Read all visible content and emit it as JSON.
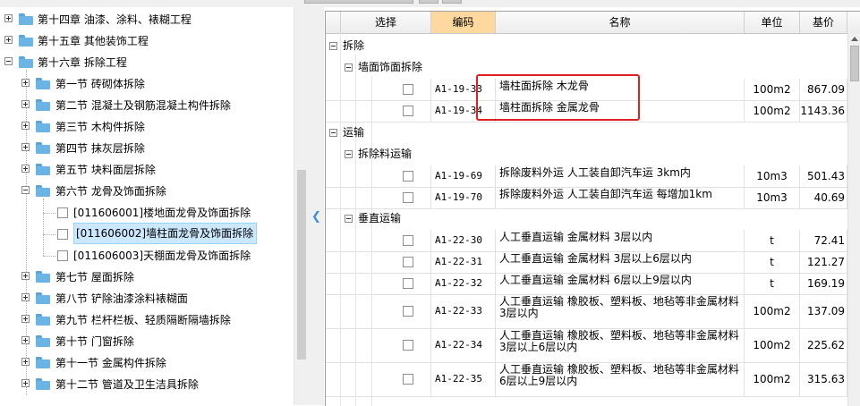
{
  "tree": [
    {
      "label": "第十四章  油漆、涂料、裱糊工程",
      "kind": "chapter",
      "expanded": false
    },
    {
      "label": "第十五章  其他装饰工程",
      "kind": "chapter",
      "expanded": false
    },
    {
      "label": "第十六章  拆除工程",
      "kind": "chapter",
      "expanded": true
    },
    {
      "label": "第一节  砖砌体拆除",
      "kind": "section",
      "expanded": false
    },
    {
      "label": "第二节  混凝土及钢筋混凝土构件拆除",
      "kind": "section",
      "expanded": false
    },
    {
      "label": "第三节  木构件拆除",
      "kind": "section",
      "expanded": false
    },
    {
      "label": "第四节  抹灰层拆除",
      "kind": "section",
      "expanded": false
    },
    {
      "label": "第五节  块料面层拆除",
      "kind": "section",
      "expanded": false
    },
    {
      "label": "第六节  龙骨及饰面拆除",
      "kind": "section",
      "expanded": true
    },
    {
      "label": "[011606001]楼地面龙骨及饰面拆除",
      "kind": "leaf",
      "selected": false
    },
    {
      "label": "[011606002]墙柱面龙骨及饰面拆除",
      "kind": "leaf",
      "selected": true
    },
    {
      "label": "[011606003]天棚面龙骨及饰面拆除",
      "kind": "leaf",
      "selected": false
    },
    {
      "label": "第七节  屋面拆除",
      "kind": "section",
      "expanded": false
    },
    {
      "label": "第八节  铲除油漆涂料裱糊面",
      "kind": "section",
      "expanded": false
    },
    {
      "label": "第九节  栏杆栏板、轻质隔断隔墙拆除",
      "kind": "section",
      "expanded": false
    },
    {
      "label": "第十节  门窗拆除",
      "kind": "section",
      "expanded": false
    },
    {
      "label": "第十一节  金属构件拆除",
      "kind": "section",
      "expanded": false
    },
    {
      "label": "第十二节  管道及卫生洁具拆除",
      "kind": "section",
      "expanded": false
    }
  ],
  "grid": {
    "headers": {
      "select": "选择",
      "code": "编码",
      "name": "名称",
      "unit": "单位",
      "price": "基价"
    },
    "groups": {
      "demolish": "拆除",
      "wall": "墙面饰面拆除",
      "transport": "运输",
      "debris": "拆除料运输",
      "vertical": "垂直运输"
    },
    "rows": [
      {
        "code": "A1-19-33",
        "name": "墙柱面拆除 木龙骨",
        "unit": "100m2",
        "price": "867.09"
      },
      {
        "code": "A1-19-34",
        "name": "墙柱面拆除 金属龙骨",
        "unit": "100m2",
        "price": "1143.36"
      },
      {
        "code": "A1-19-69",
        "name": "拆除废料外运 人工装自卸汽车运 3km内",
        "unit": "10m3",
        "price": "501.43"
      },
      {
        "code": "A1-19-70",
        "name": "拆除废料外运 人工装自卸汽车运 每增加1km",
        "unit": "10m3",
        "price": "40.69"
      },
      {
        "code": "A1-22-30",
        "name": "人工垂直运输 金属材料 3层以内",
        "unit": "t",
        "price": "72.41"
      },
      {
        "code": "A1-22-31",
        "name": "人工垂直运输 金属材料 3层以上6层以内",
        "unit": "t",
        "price": "121.27"
      },
      {
        "code": "A1-22-32",
        "name": "人工垂直运输 金属材料 6层以上9层以内",
        "unit": "t",
        "price": "169.19"
      },
      {
        "code": "A1-22-33",
        "name": "人工垂直运输 橡胶板、塑料板、地毡等非金属材料3层以内",
        "unit": "100m2",
        "price": "137.09"
      },
      {
        "code": "A1-22-34",
        "name": "人工垂直运输 橡胶板、塑料板、地毡等非金属材料3层以上6层以内",
        "unit": "100m2",
        "price": "225.62"
      },
      {
        "code": "A1-22-35",
        "name": "人工垂直运输 橡胶板、塑料板、地毡等非金属材料6层以上9层以内",
        "unit": "100m2",
        "price": "315.63"
      }
    ]
  },
  "colors": {
    "highlight": "#e02020",
    "code_header": "#fdd9a0",
    "selection": "#cce8ff"
  }
}
